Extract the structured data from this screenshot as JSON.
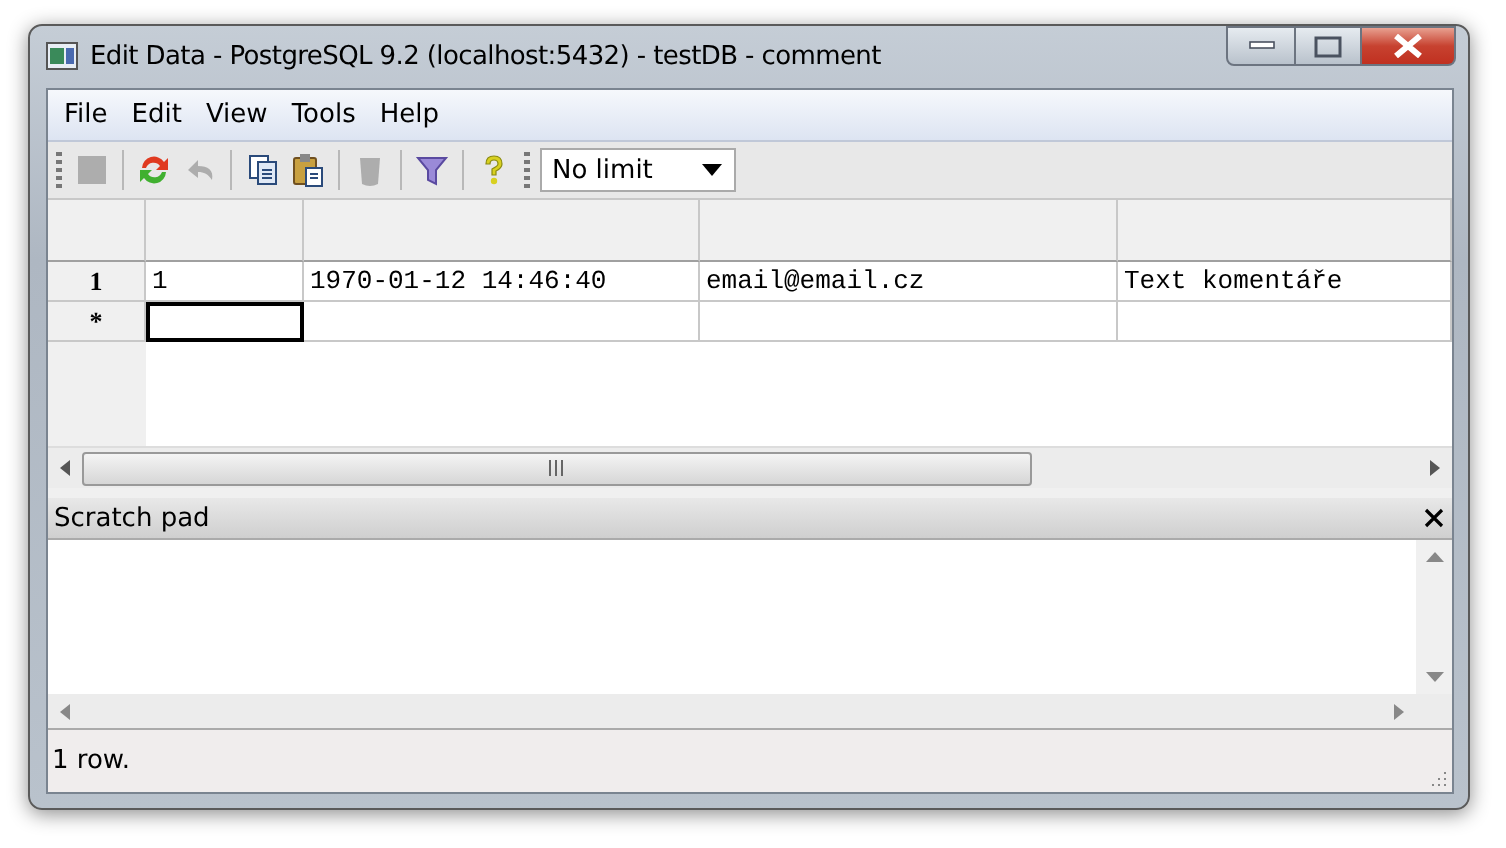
{
  "window": {
    "title": "Edit Data - PostgreSQL 9.2 (localhost:5432) - testDB - comment"
  },
  "menu": [
    "File",
    "Edit",
    "View",
    "Tools",
    "Help"
  ],
  "toolbar": [
    {
      "kind": "save",
      "disabled": true
    },
    {
      "kind": "refresh",
      "disabled": false
    },
    {
      "kind": "undo",
      "disabled": true
    },
    {
      "kind": "copy",
      "disabled": false
    },
    {
      "kind": "paste",
      "disabled": false
    },
    {
      "kind": "delete",
      "disabled": true
    },
    {
      "kind": "filter",
      "disabled": false
    },
    {
      "kind": "help",
      "disabled": false
    }
  ],
  "limit_dropdown": {
    "value": "No limit"
  },
  "table": {
    "rows": [
      {
        "header": "1",
        "cells": [
          {
            "text": "1",
            "selected": false
          },
          {
            "text": "1970-01-12 14:46:40",
            "selected": false
          },
          {
            "text": "email@email.cz",
            "selected": false
          },
          {
            "text": "Text komentáře",
            "selected": false
          }
        ]
      },
      {
        "header": "*",
        "cells": [
          {
            "selected": true
          },
          {
            "selected": false
          },
          {
            "selected": false
          },
          {
            "selected": false
          }
        ]
      }
    ]
  },
  "scratch_pad": {
    "title": "Scratch pad"
  },
  "status_bar": {
    "text": "1 row."
  }
}
